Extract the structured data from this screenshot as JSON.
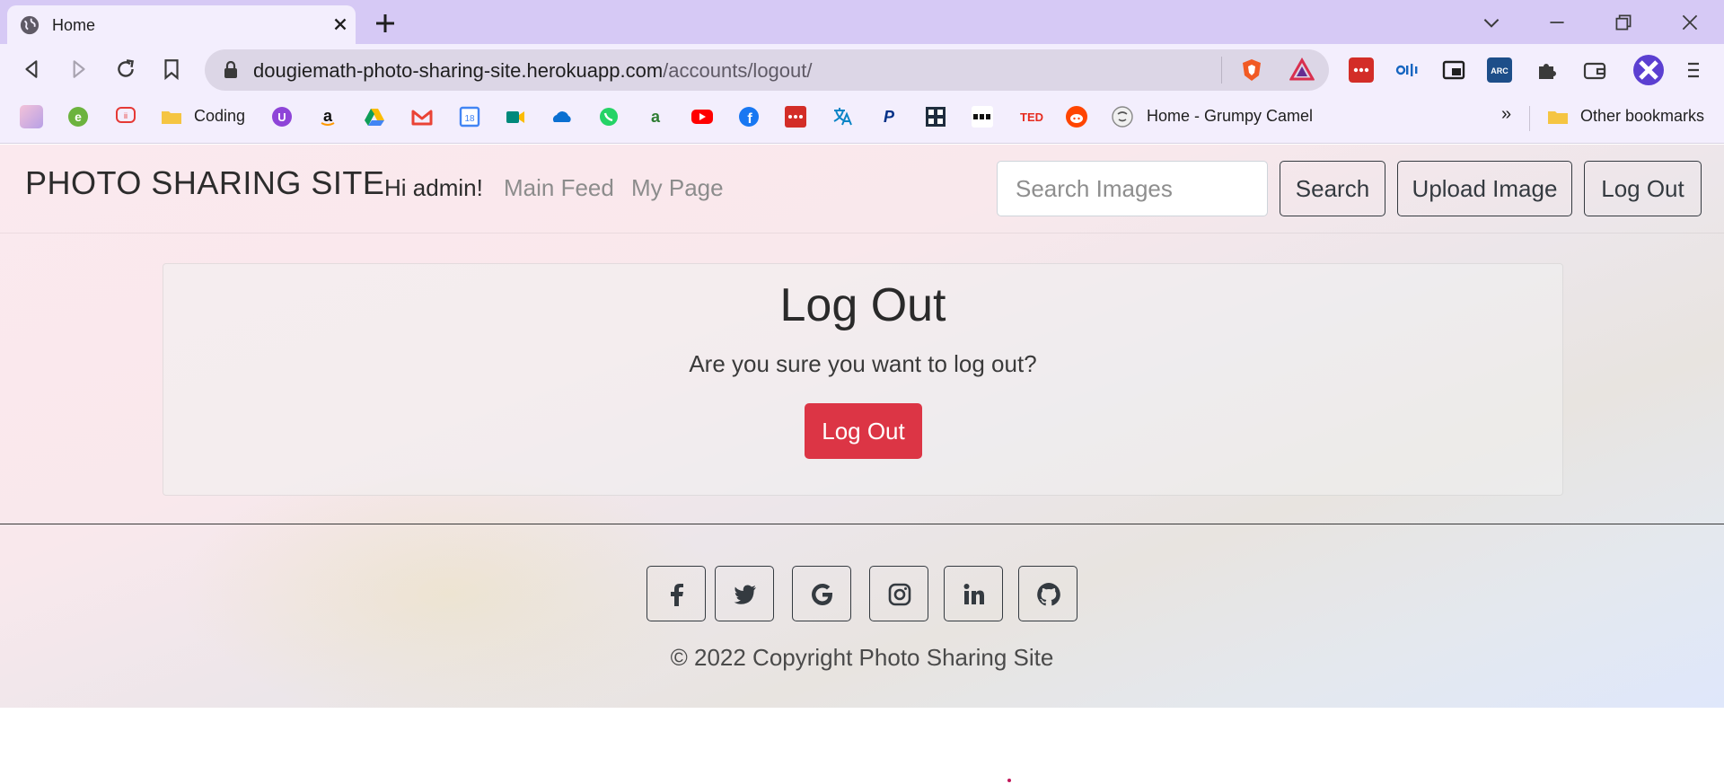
{
  "browser": {
    "tab_title": "Home",
    "url_host": "dougiemath-photo-sharing-site.herokuapp.com",
    "url_path": "/accounts/logout/",
    "bookmarks": {
      "coding_label": "Coding",
      "grumpy_label": "Home - Grumpy Camel",
      "overflow_label": "»",
      "other_label": "Other bookmarks"
    }
  },
  "site": {
    "brand": "PHOTO SHARING SITE",
    "nav": {
      "greeting": "Hi admin!",
      "main_feed": "Main Feed",
      "my_page": "My Page"
    },
    "search_placeholder": "Search Images",
    "search_button": "Search",
    "upload_button": "Upload Image",
    "logout_nav_button": "Log Out"
  },
  "logout_card": {
    "title": "Log Out",
    "message": "Are you sure you want to log out?",
    "confirm_button": "Log Out"
  },
  "footer": {
    "social_icons": [
      "facebook-icon",
      "twitter-icon",
      "google-icon",
      "instagram-icon",
      "linkedin-icon",
      "github-icon"
    ],
    "copyright": "© 2022 Copyright Photo Sharing Site"
  },
  "colors": {
    "danger": "#dc3545",
    "browser_frame": "#d6c9f5",
    "text_dark": "#343a40"
  }
}
